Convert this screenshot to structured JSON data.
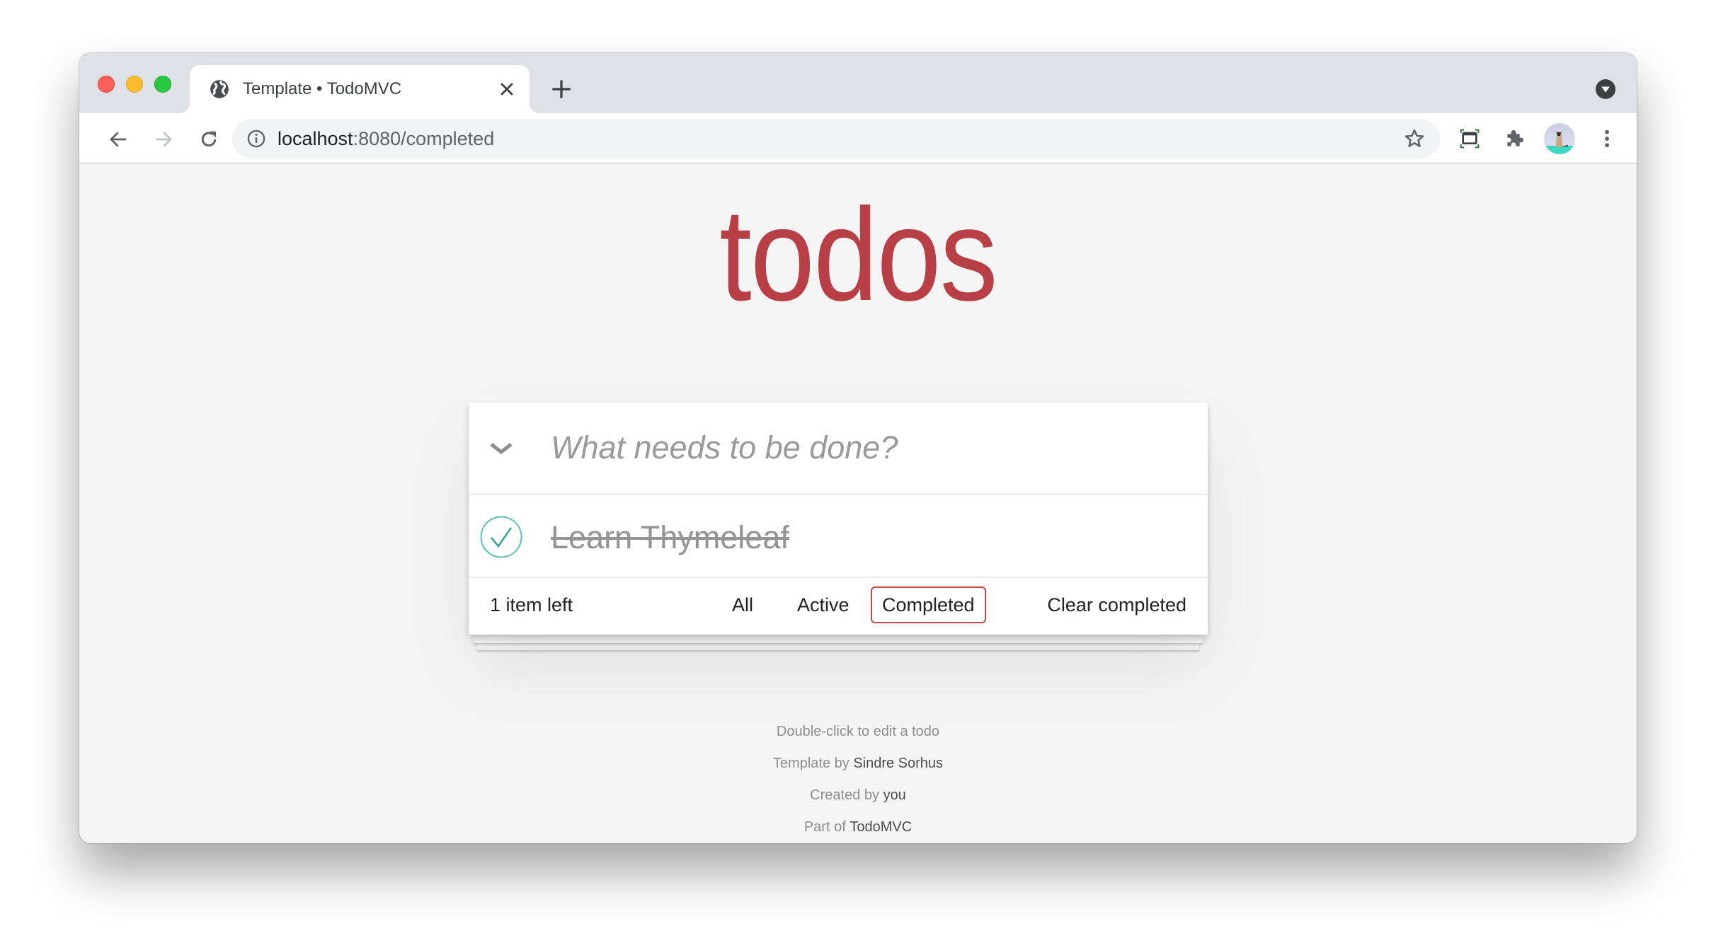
{
  "browser": {
    "tab": {
      "title": "Template • TodoMVC",
      "favicon": "globe-icon"
    },
    "url": {
      "host": "localhost",
      "rest": ":8080/completed"
    },
    "icons": [
      "back-icon",
      "forward-icon",
      "reload-icon",
      "info-icon",
      "star-icon",
      "screen-capture-icon",
      "extensions-icon",
      "profile-avatar",
      "kebab-menu-icon",
      "tab-search-icon",
      "new-tab-icon",
      "close-icon"
    ]
  },
  "app": {
    "title": "todos",
    "new_todo_placeholder": "What needs to be done?",
    "new_todo_value": "",
    "todos": [
      {
        "label": "Learn Thymeleaf",
        "completed": true
      }
    ],
    "footer": {
      "count": "1 item left",
      "filters": [
        {
          "label": "All",
          "selected": false
        },
        {
          "label": "Active",
          "selected": false
        },
        {
          "label": "Completed",
          "selected": true
        }
      ],
      "clear_completed": "Clear completed"
    },
    "info": {
      "line1": "Double-click to edit a todo",
      "line2_prefix": "Template by ",
      "line2_link": "Sindre Sorhus",
      "line3_prefix": "Created by ",
      "line3_link": "you",
      "line4_prefix": "Part of ",
      "line4_link": "TodoMVC"
    },
    "colors": {
      "title": "#b83f45",
      "selected_filter_border": "#ce4646",
      "check": "#3ea390"
    }
  }
}
